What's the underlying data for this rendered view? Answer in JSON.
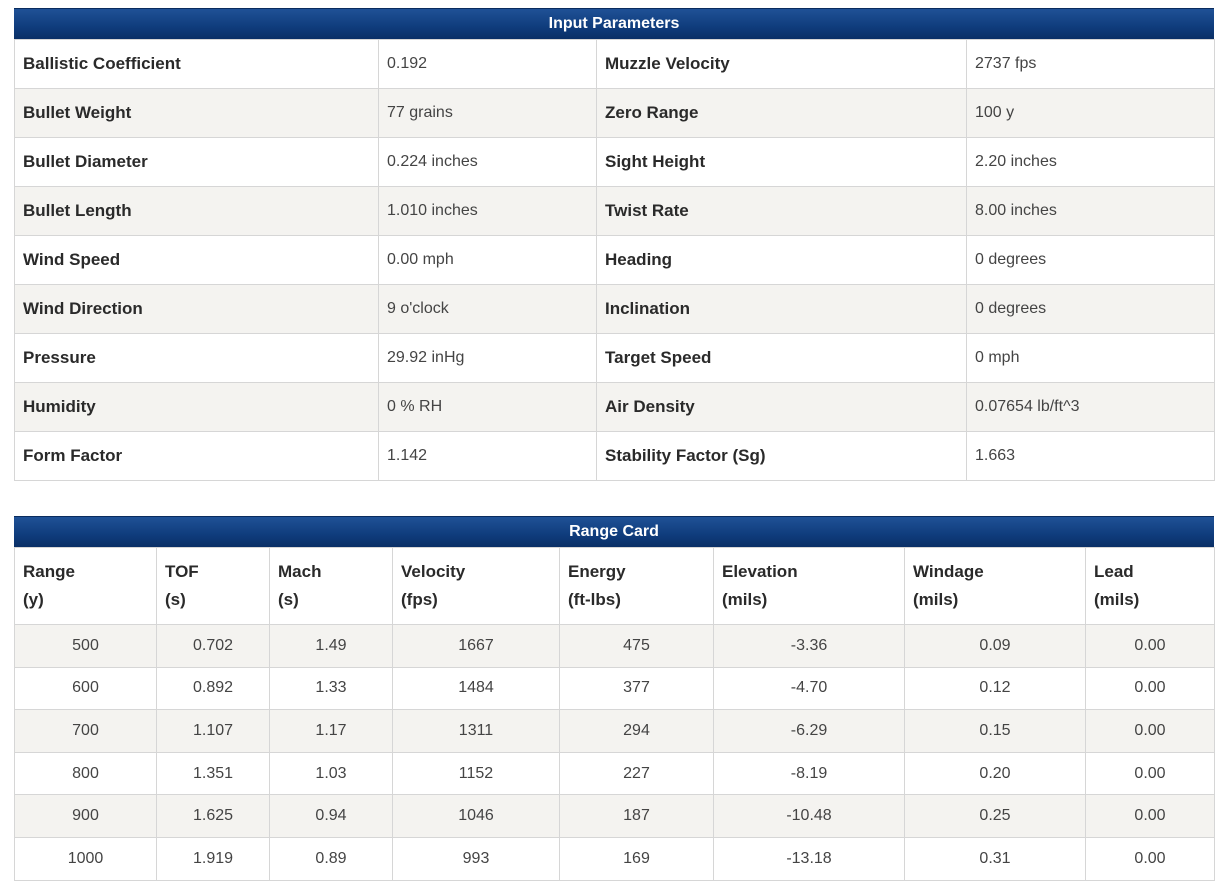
{
  "input": {
    "title": "Input Parameters",
    "rows": [
      {
        "l1": "Ballistic Coefficient",
        "v1": "0.192",
        "l2": "Muzzle Velocity",
        "v2": "2737 fps"
      },
      {
        "l1": "Bullet Weight",
        "v1": "77 grains",
        "l2": "Zero Range",
        "v2": "100 y"
      },
      {
        "l1": "Bullet Diameter",
        "v1": "0.224 inches",
        "l2": "Sight Height",
        "v2": "2.20 inches"
      },
      {
        "l1": "Bullet Length",
        "v1": "1.010 inches",
        "l2": "Twist Rate",
        "v2": "8.00 inches"
      },
      {
        "l1": "Wind Speed",
        "v1": "0.00 mph",
        "l2": "Heading",
        "v2": "0 degrees"
      },
      {
        "l1": "Wind Direction",
        "v1": "9 o'clock",
        "l2": "Inclination",
        "v2": "0 degrees"
      },
      {
        "l1": "Pressure",
        "v1": "29.92 inHg",
        "l2": "Target Speed",
        "v2": "0 mph"
      },
      {
        "l1": "Humidity",
        "v1": "0 % RH",
        "l2": "Air Density",
        "v2": "0.07654 lb/ft^3"
      },
      {
        "l1": "Form Factor",
        "v1": "1.142",
        "l2": "Stability Factor (Sg)",
        "v2": "1.663"
      }
    ]
  },
  "range_card": {
    "title": "Range Card",
    "headers": [
      {
        "name": "Range",
        "unit": "(y)"
      },
      {
        "name": "TOF",
        "unit": "(s)"
      },
      {
        "name": "Mach",
        "unit": "(s)"
      },
      {
        "name": "Velocity",
        "unit": "(fps)"
      },
      {
        "name": "Energy",
        "unit": "(ft-lbs)"
      },
      {
        "name": "Elevation",
        "unit": "(mils)"
      },
      {
        "name": "Windage",
        "unit": "(mils)"
      },
      {
        "name": "Lead",
        "unit": "(mils)"
      }
    ],
    "rows": [
      [
        "500",
        "0.702",
        "1.49",
        "1667",
        "475",
        "-3.36",
        "0.09",
        "0.00"
      ],
      [
        "600",
        "0.892",
        "1.33",
        "1484",
        "377",
        "-4.70",
        "0.12",
        "0.00"
      ],
      [
        "700",
        "1.107",
        "1.17",
        "1311",
        "294",
        "-6.29",
        "0.15",
        "0.00"
      ],
      [
        "800",
        "1.351",
        "1.03",
        "1152",
        "227",
        "-8.19",
        "0.20",
        "0.00"
      ],
      [
        "900",
        "1.625",
        "0.94",
        "1046",
        "187",
        "-10.48",
        "0.25",
        "0.00"
      ],
      [
        "1000",
        "1.919",
        "0.89",
        "993",
        "169",
        "-13.18",
        "0.31",
        "0.00"
      ]
    ]
  }
}
